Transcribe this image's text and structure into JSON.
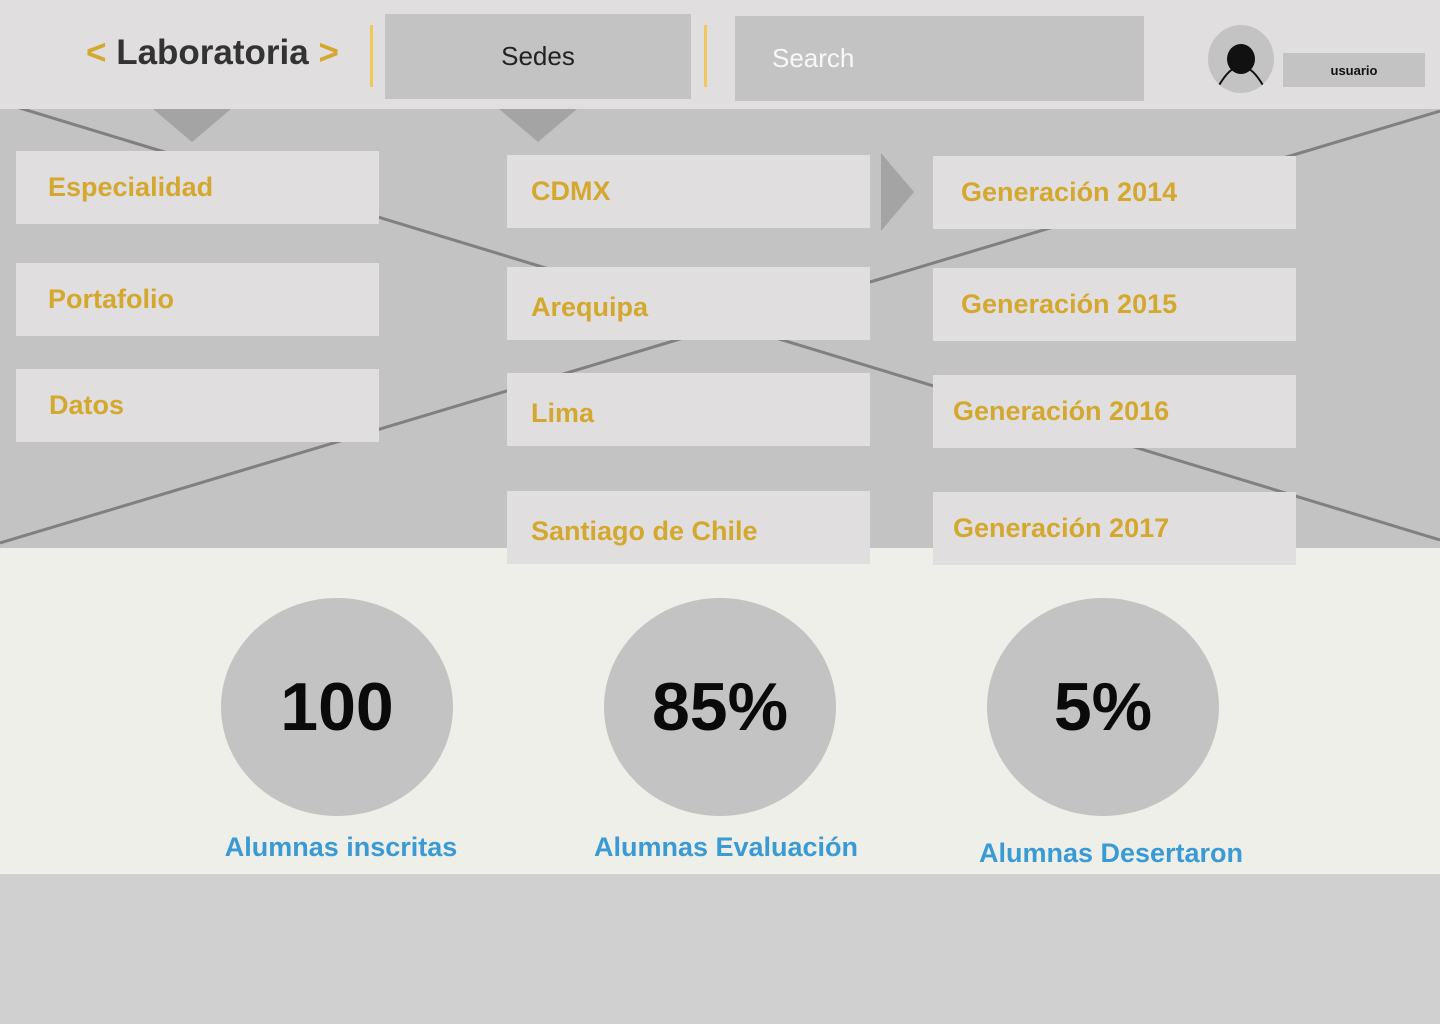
{
  "header": {
    "logo_open": "<",
    "logo_text": "Laboratoria",
    "logo_close": ">",
    "sedes_label": "Sedes",
    "search_placeholder": "Search",
    "user_label": "usuario"
  },
  "menu": {
    "left": [
      "Especialidad",
      "Portafolio",
      "Datos"
    ],
    "sedes": [
      "CDMX",
      "Arequipa",
      "Lima",
      "Santiago de Chile"
    ],
    "generaciones": [
      "Generación 2014",
      "Generación 2015",
      "Generación 2016",
      "Generación 2017"
    ]
  },
  "stats": [
    {
      "value": "100",
      "label": "Alumnas inscritas"
    },
    {
      "value": "85%",
      "label": "Alumnas Evaluación"
    },
    {
      "value": "5%",
      "label": "Alumnas Desertaron"
    }
  ],
  "colors": {
    "accent": "#d4a82e",
    "stat_label": "#3a9ad4",
    "panel": "#c3c3c3",
    "header_bg": "#e0dede",
    "stats_bg": "#efefe9"
  }
}
